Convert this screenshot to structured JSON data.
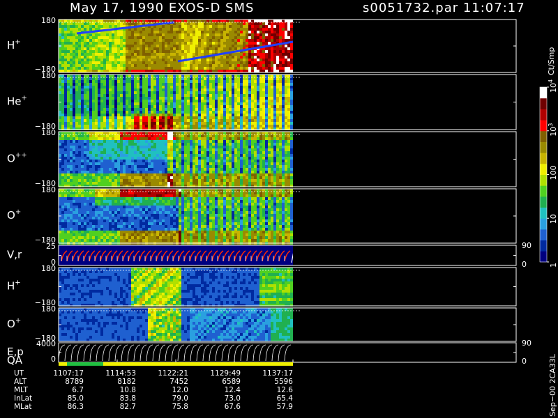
{
  "header": {
    "title": "May 17, 1990    EXOS-D SMS",
    "file_time": "s0051732.par   11:07:17"
  },
  "panels": [
    {
      "id": "hplus-top",
      "label": "H",
      "sup": "+",
      "ymax": "180",
      "ymin": "−180"
    },
    {
      "id": "heplus",
      "label": "He",
      "sup": "+",
      "ymax": "180",
      "ymin": "−180"
    },
    {
      "id": "oplusplus",
      "label": "O",
      "sup": "++",
      "ymax": "180",
      "ymin": "−180"
    },
    {
      "id": "oplus-top",
      "label": "O",
      "sup": "+",
      "ymax": "180",
      "ymin": "−180"
    },
    {
      "id": "vr",
      "label": "V,r",
      "sup": "",
      "ymax": "25",
      "ymin": "0",
      "right_max": "90",
      "right_min": "0"
    },
    {
      "id": "hplus-bot",
      "label": "H",
      "sup": "+",
      "ymax": "180",
      "ymin": "−180"
    },
    {
      "id": "oplus-bot",
      "label": "O",
      "sup": "+",
      "ymax": "180",
      "ymin": "−180"
    },
    {
      "id": "ep",
      "label": "E,p",
      "sup": "",
      "ymax": "4000",
      "ymin": "0",
      "right_max": "90",
      "right_min": "0"
    }
  ],
  "qa_label": "QA",
  "colorbar": {
    "unit": "Ct/Smp",
    "ticks": [
      {
        "text": "10",
        "sup": "4",
        "value": 4
      },
      {
        "text": "10",
        "sup": "3",
        "value": 3
      },
      {
        "text": "100",
        "sup": "",
        "value": 2
      },
      {
        "text": "10",
        "sup": "",
        "value": 1
      },
      {
        "text": "1",
        "sup": "",
        "value": 0
      }
    ],
    "colors": [
      "#000080",
      "#002aa0",
      "#1f60d0",
      "#2aa0e0",
      "#20c0c0",
      "#20b050",
      "#50d020",
      "#b0e000",
      "#f0f000",
      "#c8b400",
      "#9a8a00",
      "#806000",
      "#ff0000",
      "#b00000",
      "#700000",
      "#ffffff"
    ]
  },
  "ephemeris": {
    "rows": [
      {
        "label": "UT",
        "values": [
          "1107:17",
          "1114:53",
          "1122:21",
          "1129:49",
          "1137:17"
        ]
      },
      {
        "label": "ALT",
        "values": [
          "8789",
          "8182",
          "7452",
          "6589",
          "5596"
        ]
      },
      {
        "label": "MLT",
        "values": [
          "6.7",
          "10.8",
          "12.0",
          "12.4",
          "12.6"
        ]
      },
      {
        "label": "InLat",
        "values": [
          "85.0",
          "83.8",
          "79.0",
          "73.0",
          "65.4"
        ]
      },
      {
        "label": "MLat",
        "values": [
          "86.3",
          "82.7",
          "75.8",
          "67.6",
          "57.9"
        ]
      }
    ]
  },
  "footer_stamp": "Sep−00  2CA33L",
  "chart_data": {
    "type": "heatmap",
    "title": "May 17, 1990    EXOS-D SMS",
    "x_ticks_ut": [
      "1107:17",
      "1114:53",
      "1122:21",
      "1129:49",
      "1137:17"
    ],
    "panels": [
      "H+",
      "He+",
      "O++",
      "O+",
      "V,r",
      "H+",
      "O+",
      "E,p"
    ],
    "pitch_angle_range": [
      -180,
      180
    ],
    "vr_range": [
      0,
      25
    ],
    "ep_range": [
      0,
      4000
    ],
    "right_axis_range": [
      0,
      90
    ],
    "colorbar_log_range": [
      0,
      4
    ],
    "colorbar_unit": "Ct/Smp"
  }
}
